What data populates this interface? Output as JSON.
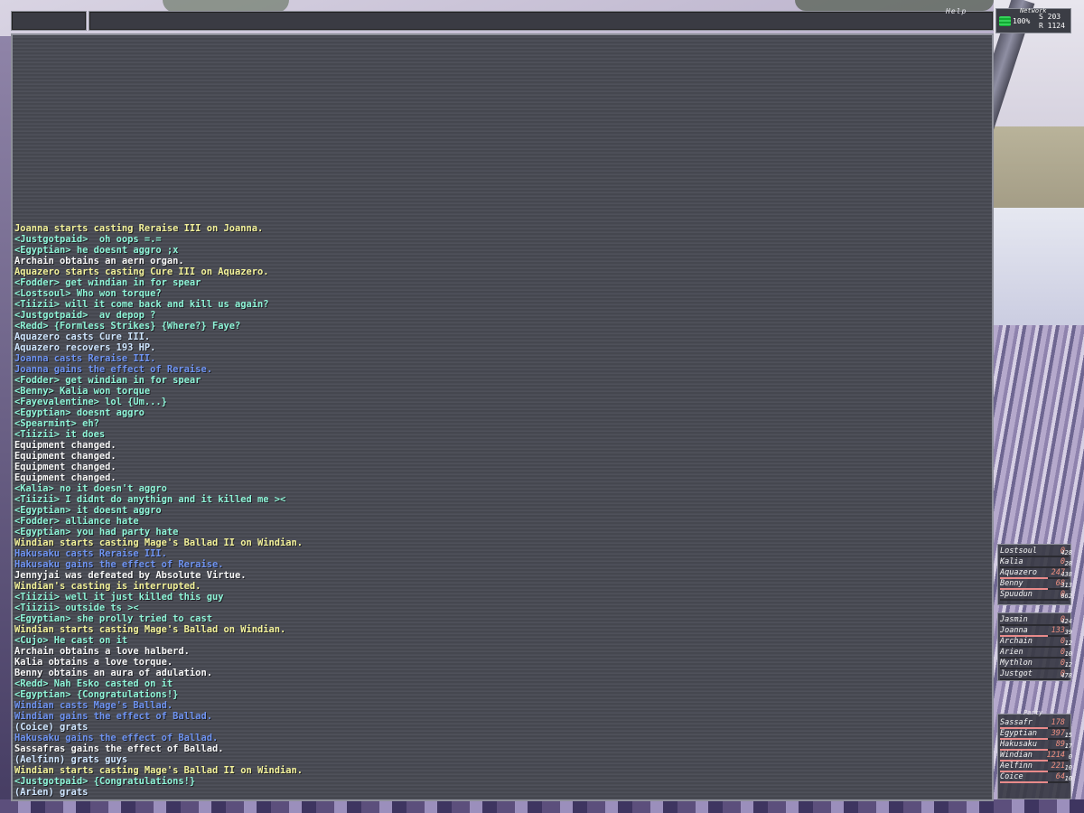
{
  "header": {
    "help_label": "Help",
    "network_label": "Network",
    "network_percent": "100%",
    "network_s": "S 203",
    "network_r": "R 1124"
  },
  "chat": {
    "lines": [
      {
        "text": "Joanna starts casting Reraise III on Joanna.",
        "color": "yellow"
      },
      {
        "text": "<Justgotpaid>  oh oops =.=",
        "color": "green"
      },
      {
        "text": "<Egyptian> he doesnt aggro ;x",
        "color": "green"
      },
      {
        "text": "Archain obtains an aern organ.",
        "color": "white"
      },
      {
        "text": "Aquazero starts casting Cure III on Aquazero.",
        "color": "yellow"
      },
      {
        "text": "<Fodder> get windian in for spear",
        "color": "green"
      },
      {
        "text": "<Lostsoul> Who won torque?",
        "color": "green"
      },
      {
        "text": "<Tiizii> will it come back and kill us again?",
        "color": "green"
      },
      {
        "text": "<Justgotpaid>  av depop ?",
        "color": "green"
      },
      {
        "text": "<Redd> {Formless Strikes} {Where?} Faye?",
        "color": "green"
      },
      {
        "text": "Aquazero casts Cure III.",
        "color": "pale"
      },
      {
        "text": "Aquazero recovers 193 HP.",
        "color": "pale"
      },
      {
        "text": "Joanna casts Reraise III.",
        "color": "blue"
      },
      {
        "text": "Joanna gains the effect of Reraise.",
        "color": "blue"
      },
      {
        "text": "<Fodder> get windian in for spear",
        "color": "green"
      },
      {
        "text": "<Benny> Kalia won torque",
        "color": "green"
      },
      {
        "text": "<Fayevalentine> lol {Um...}",
        "color": "green"
      },
      {
        "text": "<Egyptian> doesnt aggro",
        "color": "green"
      },
      {
        "text": "<Spearmint> eh?",
        "color": "green"
      },
      {
        "text": "<Tiizii> it does",
        "color": "green"
      },
      {
        "text": "Equipment changed.",
        "color": "white"
      },
      {
        "text": "Equipment changed.",
        "color": "white"
      },
      {
        "text": "Equipment changed.",
        "color": "white"
      },
      {
        "text": "Equipment changed.",
        "color": "white"
      },
      {
        "text": "<Kalia> no it doesn't aggro",
        "color": "green"
      },
      {
        "text": "<Tiizii> I didnt do anythign and it killed me ><",
        "color": "green"
      },
      {
        "text": "<Egyptian> it doesnt aggro",
        "color": "green"
      },
      {
        "text": "<Fodder> alliance hate",
        "color": "green"
      },
      {
        "text": "<Egyptian> you had party hate",
        "color": "green"
      },
      {
        "text": "Windian starts casting Mage's Ballad II on Windian.",
        "color": "yellow"
      },
      {
        "text": "Hakusaku casts Reraise III.",
        "color": "blue"
      },
      {
        "text": "Hakusaku gains the effect of Reraise.",
        "color": "blue"
      },
      {
        "text": "Jennyjai was defeated by Absolute Virtue.",
        "color": "white"
      },
      {
        "text": "Windian's casting is interrupted.",
        "color": "yellow"
      },
      {
        "text": "<Tiizii> well it just killed this guy",
        "color": "green"
      },
      {
        "text": "<Tiizii> outside ts ><",
        "color": "green"
      },
      {
        "text": "<Egyptian> she prolly tried to cast",
        "color": "green"
      },
      {
        "text": "Windian starts casting Mage's Ballad on Windian.",
        "color": "yellow"
      },
      {
        "text": "<Cujo> He cast on it",
        "color": "green"
      },
      {
        "text": "Archain obtains a love halberd.",
        "color": "white"
      },
      {
        "text": "Kalia obtains a love torque.",
        "color": "white"
      },
      {
        "text": "Benny obtains an aura of adulation.",
        "color": "white"
      },
      {
        "text": "<Redd> Nah Esko casted on it",
        "color": "green"
      },
      {
        "text": "<Egyptian> {Congratulations!}",
        "color": "green"
      },
      {
        "text": "Windian casts Mage's Ballad.",
        "color": "blue"
      },
      {
        "text": "Windian gains the effect of Ballad.",
        "color": "blue"
      },
      {
        "text": "(Coice) grats",
        "color": "pale"
      },
      {
        "text": "Hakusaku gains the effect of Ballad.",
        "color": "blue"
      },
      {
        "text": "Sassafras gains the effect of Ballad.",
        "color": "white"
      },
      {
        "text": "(Aelfinn) grats guys",
        "color": "pale"
      },
      {
        "text": "Windian starts casting Mage's Ballad II on Windian.",
        "color": "yellow"
      },
      {
        "text": "<Justgotpaid> {Congratulations!}",
        "color": "green"
      },
      {
        "text": "(Arien) grats",
        "color": "pale"
      }
    ]
  },
  "alliance1": [
    {
      "name": "Lostsoul",
      "value": "0",
      "side": "428"
    },
    {
      "name": "Kalia",
      "value": "0",
      "side": "28"
    },
    {
      "name": "Aquazero",
      "value": "247",
      "side": "438"
    },
    {
      "name": "Benny",
      "value": "68",
      "side": "313"
    },
    {
      "name": "Spuudun",
      "value": "0",
      "side": "662"
    }
  ],
  "alliance2": [
    {
      "name": "Jasmin",
      "value": "0",
      "side": "424"
    },
    {
      "name": "Joanna",
      "value": "133",
      "side": "39"
    },
    {
      "name": "Archain",
      "value": "0",
      "side": "12"
    },
    {
      "name": "Arien",
      "value": "0",
      "side": "10"
    },
    {
      "name": "Mythlon",
      "value": "0",
      "side": "12"
    },
    {
      "name": "Justgot",
      "value": "0",
      "side": "478"
    }
  ],
  "party": {
    "label": "Party",
    "members": [
      {
        "name": "Sassafr",
        "value": "178",
        "side": ""
      },
      {
        "name": "Egyptian",
        "value": "397",
        "side": "15"
      },
      {
        "name": "Hakusaku",
        "value": "89",
        "side": "17"
      },
      {
        "name": "Windian",
        "value": "1214",
        "side": "0"
      },
      {
        "name": "Aelfinn",
        "value": "221",
        "side": "10"
      },
      {
        "name": "Coice",
        "value": "64",
        "side": "10"
      }
    ]
  }
}
